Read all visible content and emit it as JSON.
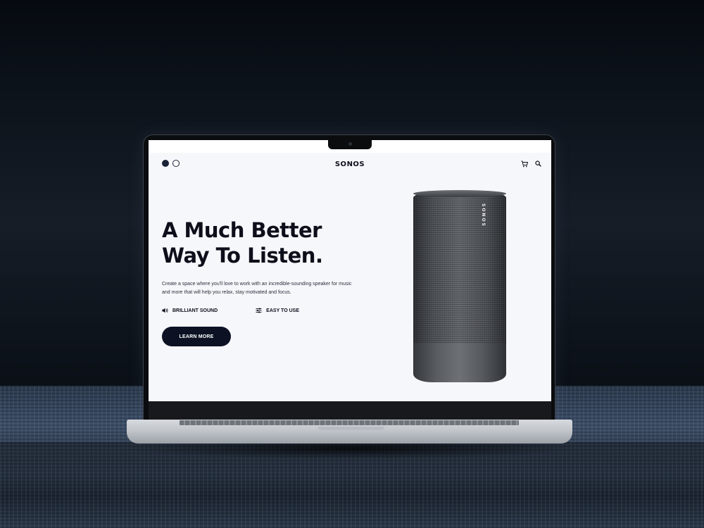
{
  "site": {
    "brand": "SONOS",
    "nav": {
      "dot_icons": [
        "filled-circle-icon",
        "outline-circle-icon"
      ],
      "icons": [
        "cart-icon",
        "search-icon"
      ]
    },
    "hero": {
      "headline_line1": "A Much Better",
      "headline_line2": "Way To Listen.",
      "description": "Create a space where you'll love to work with an incredible-sounding speaker for music and more that will help you relax, stay motivated and focus.",
      "features": [
        {
          "icon": "speaker-icon",
          "label": "BRILLIANT SOUND"
        },
        {
          "icon": "sliders-icon",
          "label": "EASY TO USE"
        }
      ],
      "cta_label": "LEARN MORE"
    },
    "product": {
      "name": "speaker",
      "brand_text": "SONOS"
    }
  },
  "colors": {
    "primary": "#0c1224",
    "page_background": "#f5f7fb",
    "text": "#0c0f1a",
    "speaker": "#4c5055"
  }
}
